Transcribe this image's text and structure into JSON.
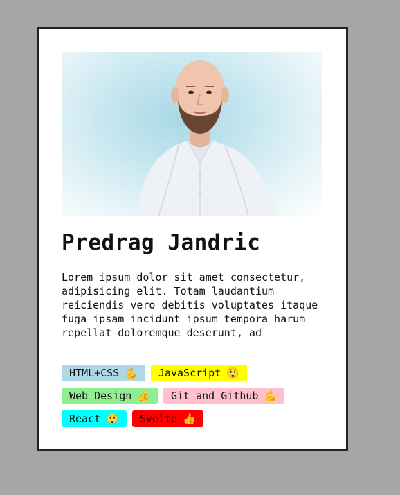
{
  "profile": {
    "name": "Predrag Jandric",
    "bio": "Lorem ipsum dolor sit amet consectetur, adipisicing elit. Totam laudantium reiciendis vero debitis voluptates itaque fuga ipsam incidunt ipsum tempora harum repellat doloremque deserunt, ad",
    "photo_icon": "person-photo"
  },
  "tags": [
    {
      "label": "HTML+CSS",
      "emoji": "💪",
      "icon": "flexed-biceps-icon",
      "color": "#add8e6"
    },
    {
      "label": "JavaScript",
      "emoji": "😲",
      "icon": "astonished-face-icon",
      "color": "#ffff00"
    },
    {
      "label": "Web Design",
      "emoji": "👍",
      "icon": "thumbs-up-icon",
      "color": "#90ee90"
    },
    {
      "label": "Git and Github",
      "emoji": "💪",
      "icon": "flexed-biceps-icon",
      "color": "#ffc0cb"
    },
    {
      "label": "React",
      "emoji": "😲",
      "icon": "astonished-face-icon",
      "color": "#00ffff"
    },
    {
      "label": "Svelte",
      "emoji": "👍",
      "icon": "thumbs-up-icon",
      "color": "#ff0000"
    }
  ],
  "colors": {
    "page_background": "#a6a6a6",
    "card_background": "#ffffff",
    "card_border": "#222222"
  }
}
